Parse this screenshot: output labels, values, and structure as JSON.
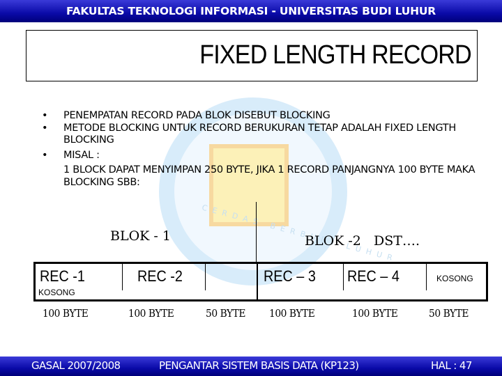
{
  "header": {
    "text": "FAKULTAS TEKNOLOGI INFORMASI - UNIVERSITAS BUDI LUHUR"
  },
  "title": "FIXED LENGTH RECORD",
  "watermark": {
    "text": "CERDAS BERBUDI LUHUR"
  },
  "bullets": [
    {
      "text": "PENEMPATAN RECORD PADA BLOK DISEBUT BLOCKING"
    },
    {
      "text": "METODE BLOCKING UNTUK RECORD BERUKURAN TETAP ADALAH FIXED LENGTH BLOCKING"
    },
    {
      "text": "MISAL :"
    }
  ],
  "example_text": "1 BLOCK DAPAT MENYIMPAN 250 BYTE, JIKA 1 RECORD PANJANGNYA 100 BYTE MAKA BLOCKING SBB:",
  "diagram": {
    "blok1": "BLOK - 1",
    "blok2": "BLOK -2   DST….",
    "cells": [
      "REC -1",
      "REC -2",
      "REC – 3",
      "REC – 4"
    ],
    "empty_label_1": "KOSONG",
    "empty_label_2": "KOSONG",
    "sizes": [
      "100 BYTE",
      "100 BYTE",
      "50 BYTE",
      "100 BYTE",
      "100 BYTE",
      "50 BYTE"
    ]
  },
  "footer": {
    "left": "GASAL 2007/2008",
    "center": "PENGANTAR SISTEM BASIS DATA (KP123)",
    "right": "HAL : 47"
  }
}
